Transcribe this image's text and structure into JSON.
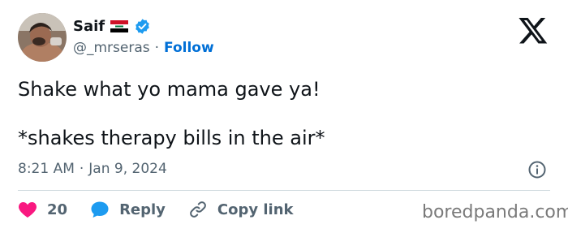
{
  "author": {
    "name": "Saif",
    "handle": "@_mrseras",
    "follow_label": "Follow",
    "flag_icon": "iraq-flag-icon",
    "verified_icon": "verified-badge-icon"
  },
  "platform_icon": "x-logo-icon",
  "tweet": {
    "line1": "Shake what yo mama gave ya!",
    "line2": "*shakes therapy bills in the air*"
  },
  "meta": {
    "time": "8:21 AM",
    "date": "Jan 9, 2024"
  },
  "actions": {
    "like_count": "20",
    "reply_label": "Reply",
    "copy_link_label": "Copy link"
  },
  "watermark": "boredpanda.com",
  "colors": {
    "text": "#0f1419",
    "muted": "#536471",
    "link": "#006fd6",
    "verified": "#1d9bf0",
    "like": "#f91880",
    "reply": "#1d9bf0"
  }
}
